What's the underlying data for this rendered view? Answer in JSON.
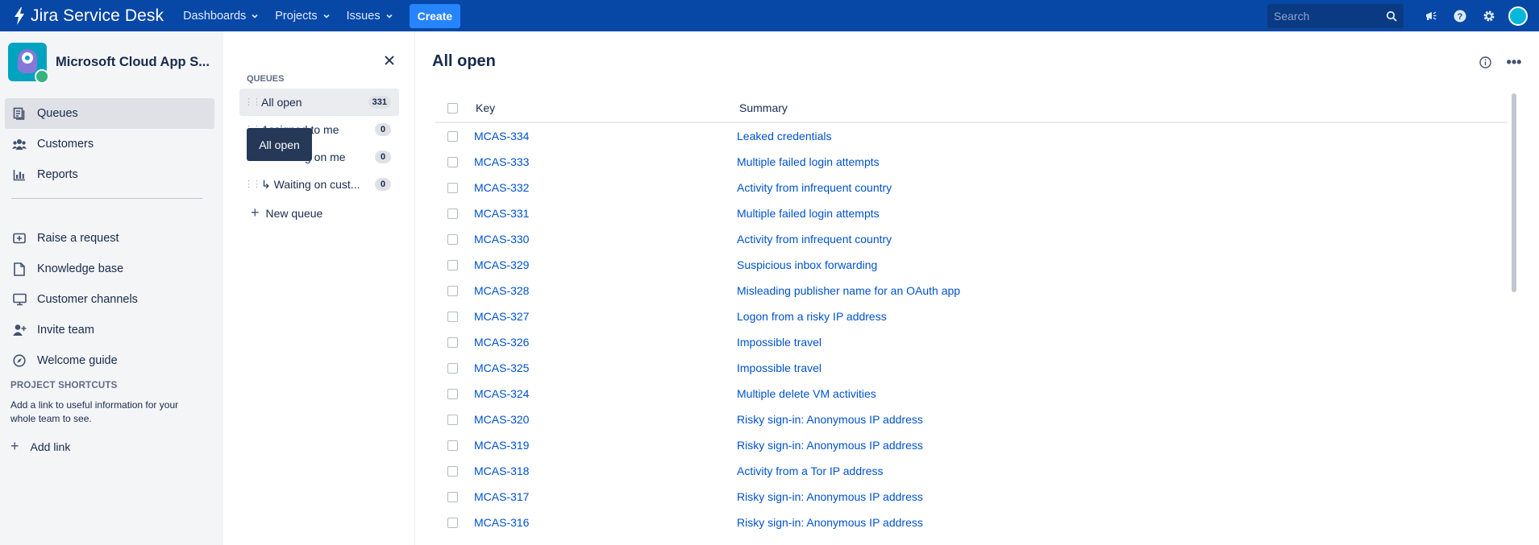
{
  "topbar": {
    "product": "Jira Service Desk",
    "nav": [
      "Dashboards",
      "Projects",
      "Issues"
    ],
    "create_label": "Create",
    "search_placeholder": "Search"
  },
  "sidebar": {
    "project_name": "Microsoft Cloud App S...",
    "items": [
      {
        "label": "Queues",
        "icon": "queues-icon"
      },
      {
        "label": "Customers",
        "icon": "customers-icon"
      },
      {
        "label": "Reports",
        "icon": "reports-icon"
      },
      {
        "label": "Raise a request",
        "icon": "raise-request-icon"
      },
      {
        "label": "Knowledge base",
        "icon": "knowledge-base-icon"
      },
      {
        "label": "Customer channels",
        "icon": "monitor-icon"
      },
      {
        "label": "Invite team",
        "icon": "invite-icon"
      },
      {
        "label": "Welcome guide",
        "icon": "compass-icon"
      }
    ],
    "shortcuts_title": "PROJECT SHORTCUTS",
    "shortcuts_text": "Add a link to useful information for your whole team to see.",
    "add_link": "Add link"
  },
  "queues": {
    "title": "QUEUES",
    "items": [
      {
        "label": "All open",
        "count": "331"
      },
      {
        "label": "Assigned to me",
        "count": "0"
      },
      {
        "label": "↳ Waiting on me",
        "count": "0"
      },
      {
        "label": "↳ Waiting on cust...",
        "count": "0"
      }
    ],
    "new_queue": "New queue",
    "tooltip": "All open"
  },
  "main": {
    "title": "All open",
    "columns": {
      "key": "Key",
      "summary": "Summary"
    },
    "rows": [
      {
        "key": "MCAS-334",
        "summary": "Leaked credentials"
      },
      {
        "key": "MCAS-333",
        "summary": "Multiple failed login attempts"
      },
      {
        "key": "MCAS-332",
        "summary": "Activity from infrequent country"
      },
      {
        "key": "MCAS-331",
        "summary": "Multiple failed login attempts"
      },
      {
        "key": "MCAS-330",
        "summary": "Activity from infrequent country"
      },
      {
        "key": "MCAS-329",
        "summary": "Suspicious inbox forwarding"
      },
      {
        "key": "MCAS-328",
        "summary": "Misleading publisher name for an OAuth app"
      },
      {
        "key": "MCAS-327",
        "summary": "Logon from a risky IP address"
      },
      {
        "key": "MCAS-326",
        "summary": "Impossible travel"
      },
      {
        "key": "MCAS-325",
        "summary": "Impossible travel"
      },
      {
        "key": "MCAS-324",
        "summary": "Multiple delete VM activities"
      },
      {
        "key": "MCAS-320",
        "summary": "Risky sign-in: Anonymous IP address"
      },
      {
        "key": "MCAS-319",
        "summary": "Risky sign-in: Anonymous IP address"
      },
      {
        "key": "MCAS-318",
        "summary": "Activity from a Tor IP address"
      },
      {
        "key": "MCAS-317",
        "summary": "Risky sign-in: Anonymous IP address"
      },
      {
        "key": "MCAS-316",
        "summary": "Risky sign-in: Anonymous IP address"
      }
    ]
  },
  "colors": {
    "topbar": "#0747a6",
    "accent": "#2684ff",
    "link": "#0052cc"
  }
}
